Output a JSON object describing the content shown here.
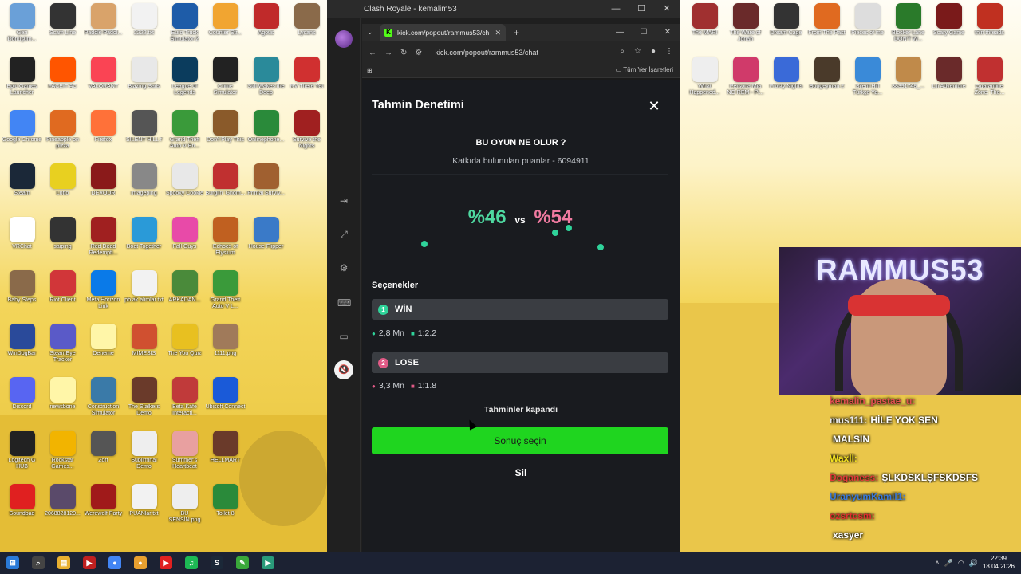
{
  "outer_window": {
    "title": "Clash Royale - kemalim53"
  },
  "browser": {
    "tab_title": "kick.com/popout/rammus53/ch",
    "url": "kick.com/popout/rammus53/chat",
    "bookmarks_all": "Tüm Yer İşaretleri"
  },
  "prediction": {
    "title": "Tahmin Denetimi",
    "question": "BU OYUN NE OLUR ?",
    "points_label": "Katkıda bulunulan puanlar - 6094911",
    "percent_a": "%46",
    "vs": "vs",
    "percent_b": "%54",
    "options_label": "Seçenekler",
    "options": [
      {
        "num": "1",
        "label": "WİN",
        "amount": "2,8 Mn",
        "ratio": "1:2.2",
        "color": "#2fd39a"
      },
      {
        "num": "2",
        "label": "LOSE",
        "amount": "3,3 Mn",
        "ratio": "1:1.8",
        "color": "#e05a86"
      }
    ],
    "closed_text": "Tahminler kapandı",
    "result_button": "Sonuç seçin",
    "delete_button": "Sil"
  },
  "chat_overlay": [
    {
      "user": "kemalin_pastae_u:",
      "text": ""
    },
    {
      "user": "mus111:",
      "text": "HİLE YOK SEN"
    },
    {
      "user": "",
      "text": "MALSIN"
    },
    {
      "user": "Waxll:",
      "text": ""
    },
    {
      "user": "Doganess:",
      "text": "ŞLKDSKLŞFSKDSFS"
    },
    {
      "user": "UranyumKamil1:",
      "text": ""
    },
    {
      "user": "ozsrtcsm:",
      "text": ""
    },
    {
      "user": "",
      "text": "xasyer"
    }
  ],
  "webcam": {
    "banner": "RAMMUS53"
  },
  "desktop_left_icons": [
    {
      "label": "Geri Dönüşüm...",
      "color": "#6aa0d8",
      "icon": "recycle-bin"
    },
    {
      "label": "Scam Line",
      "color": "#333",
      "icon": "app"
    },
    {
      "label": "Paddle Paddl...",
      "color": "#d9a36a",
      "icon": "app"
    },
    {
      "label": "2222.txt",
      "color": "#f2f2f2",
      "icon": "file"
    },
    {
      "label": "Euro Truck Simulator 2",
      "color": "#1e5ca8",
      "icon": "app"
    },
    {
      "label": "Counter Str...",
      "color": "#f1a531",
      "icon": "app"
    },
    {
      "label": "Agous",
      "color": "#c02a2a",
      "icon": "app"
    },
    {
      "label": "Lycans",
      "color": "#8a6a4a",
      "icon": "app"
    },
    {
      "label": "Epic Games Launcher",
      "color": "#222",
      "icon": "app"
    },
    {
      "label": "FACEIT AC",
      "color": "#ff5500",
      "icon": "app"
    },
    {
      "label": "VALORANT",
      "color": "#fa4454",
      "icon": "app"
    },
    {
      "label": "Blazing Sails",
      "color": "#e8e8e8",
      "icon": "app"
    },
    {
      "label": "League of Legends",
      "color": "#0b3c5d",
      "icon": "app"
    },
    {
      "label": "Crime Simulator",
      "color": "#222",
      "icon": "app"
    },
    {
      "label": "Still Wakes the Deep",
      "color": "#2a8a9a",
      "icon": "app"
    },
    {
      "label": "RV There Yet",
      "color": "#d03030",
      "icon": "app"
    },
    {
      "label": "Google Chrome",
      "color": "#4285f4",
      "icon": "app"
    },
    {
      "label": "Pineapple on pizza",
      "color": "#e06a20",
      "icon": "app"
    },
    {
      "label": "Firefox",
      "color": "#ff7139",
      "icon": "app"
    },
    {
      "label": "SILENT HILL f",
      "color": "#555",
      "icon": "app"
    },
    {
      "label": "Grand Theft Auto V En...",
      "color": "#3a9a3a",
      "icon": "app"
    },
    {
      "label": "Don't Play This",
      "color": "#8a5a2a",
      "icon": "app"
    },
    {
      "label": "Onlinephone...",
      "color": "#2a8a3a",
      "icon": "app"
    },
    {
      "label": "Survive the Nights",
      "color": "#a02020",
      "icon": "app"
    },
    {
      "label": "Steam",
      "color": "#1b2838",
      "icon": "app"
    },
    {
      "label": "Lotto",
      "color": "#e8d020",
      "icon": "app"
    },
    {
      "label": "DEVOUR",
      "color": "#8a1a1a",
      "icon": "app"
    },
    {
      "label": "imageping",
      "color": "#888",
      "icon": "file"
    },
    {
      "label": "Spooky Cookie",
      "color": "#e8e8e8",
      "icon": "file"
    },
    {
      "label": "Burglin' Gnom...",
      "color": "#c03030",
      "icon": "app"
    },
    {
      "label": "Primal Surviv...",
      "color": "#a06030",
      "icon": "app"
    },
    {
      "label": "",
      "color": "transparent",
      "icon": "blank"
    },
    {
      "label": "VRChat",
      "color": "#fff",
      "icon": "app"
    },
    {
      "label": "saiping",
      "color": "#333",
      "icon": "file"
    },
    {
      "label": "Red Dead Redempti...",
      "color": "#a02020",
      "icon": "app"
    },
    {
      "label": "Boat Together",
      "color": "#2a9ad8",
      "icon": "app"
    },
    {
      "label": "Fall Guys",
      "color": "#e84aa8",
      "icon": "app"
    },
    {
      "label": "Echoes of Elysium",
      "color": "#c06020",
      "icon": "app"
    },
    {
      "label": "House Flipper",
      "color": "#3a7ac8",
      "icon": "app"
    },
    {
      "label": "",
      "color": "transparent",
      "icon": "blank"
    },
    {
      "label": "Baby Steps",
      "color": "#8a6a4a",
      "icon": "app"
    },
    {
      "label": "Riot Client",
      "color": "#d13639",
      "icon": "app"
    },
    {
      "label": "Meta Horizon Link",
      "color": "#0a7ae8",
      "icon": "app"
    },
    {
      "label": "pb.ak alimlar.txt",
      "color": "#f2f2f2",
      "icon": "file"
    },
    {
      "label": "ARKADAN...",
      "color": "#4a8a3a",
      "icon": "app"
    },
    {
      "label": "Grand Theft Auto V L...",
      "color": "#3a9a3a",
      "icon": "app"
    },
    {
      "label": "",
      "color": "transparent",
      "icon": "blank"
    },
    {
      "label": "",
      "color": "transparent",
      "icon": "blank"
    },
    {
      "label": "WinDbgBar",
      "color": "#2a4a9a",
      "icon": "app"
    },
    {
      "label": "SteamEye Tracker",
      "color": "#5a5ac8",
      "icon": "app"
    },
    {
      "label": "Deneme",
      "color": "#fff6a8",
      "icon": "file"
    },
    {
      "label": "MIMESIS",
      "color": "#d05030",
      "icon": "app"
    },
    {
      "label": "The You Quiz",
      "color": "#e8c020",
      "icon": "app"
    },
    {
      "label": "1111.png",
      "color": "#a07a5a",
      "icon": "file"
    },
    {
      "label": "",
      "color": "transparent",
      "icon": "blank"
    },
    {
      "label": "",
      "color": "transparent",
      "icon": "blank"
    },
    {
      "label": "Discord",
      "color": "#5865f2",
      "icon": "app"
    },
    {
      "label": "newsbone",
      "color": "#fff6a8",
      "icon": "file"
    },
    {
      "label": "Construction Simulator",
      "color": "#3a7aa8",
      "icon": "app"
    },
    {
      "label": "The Stalkers Demo",
      "color": "#6a3a2a",
      "icon": "app"
    },
    {
      "label": "Beta Kafe Interacti...",
      "color": "#c03a3a",
      "icon": "app"
    },
    {
      "label": "Ubisoft Connect",
      "color": "#1a5ad8",
      "icon": "app"
    },
    {
      "label": "",
      "color": "transparent",
      "icon": "blank"
    },
    {
      "label": "",
      "color": "transparent",
      "icon": "blank"
    },
    {
      "label": "Logitech G HUB",
      "color": "#222",
      "icon": "app"
    },
    {
      "label": "Rockstar Games...",
      "color": "#f2b400",
      "icon": "app"
    },
    {
      "label": "Zort",
      "color": "#555",
      "icon": "app"
    },
    {
      "label": "Subliminal Demo",
      "color": "#eee",
      "icon": "app"
    },
    {
      "label": "Summer's Heartbeat",
      "color": "#e8a0a0",
      "icon": "app"
    },
    {
      "label": "HELLMART",
      "color": "#6a3a2a",
      "icon": "app"
    },
    {
      "label": "",
      "color": "transparent",
      "icon": "blank"
    },
    {
      "label": "",
      "color": "transparent",
      "icon": "blank"
    },
    {
      "label": "Soundpad",
      "color": "#e02020",
      "icon": "app"
    },
    {
      "label": "2068828120...",
      "color": "#5a4a6a",
      "icon": "file"
    },
    {
      "label": "Werewolf Party",
      "color": "#a01a1a",
      "icon": "app"
    },
    {
      "label": "PUANlar.txt",
      "color": "#f2f2f2",
      "icon": "file"
    },
    {
      "label": "BU SENSİN.png",
      "color": "#eee",
      "icon": "file"
    },
    {
      "label": "Toilet 8",
      "color": "#2a8a3a",
      "icon": "app"
    }
  ],
  "desktop_right_icons": [
    {
      "label": "The MARI",
      "color": "#a03030",
      "icon": "app"
    },
    {
      "label": "The Ware of Jonah",
      "color": "#6a2a2a",
      "icon": "app"
    },
    {
      "label": "Dream Cage",
      "color": "#333",
      "icon": "app"
    },
    {
      "label": "From The Past",
      "color": "#e06a20",
      "icon": "app"
    },
    {
      "label": "Pieces of me",
      "color": "#ddd",
      "icon": "app"
    },
    {
      "label": "Blocker Lane DON'T W...",
      "color": "#2a7a2a",
      "icon": "app"
    },
    {
      "label": "Scary Game",
      "color": "#7a1a1a",
      "icon": "app"
    },
    {
      "label": "thin threads",
      "color": "#c03020",
      "icon": "app"
    },
    {
      "label": "What Happened...",
      "color": "#eee",
      "icon": "app"
    },
    {
      "label": "Persona Mia NO REM - Pi...",
      "color": "#d03a6a",
      "icon": "app"
    },
    {
      "label": "Frosty Nights",
      "color": "#3a6ad8",
      "icon": "app"
    },
    {
      "label": "Boogeyman 2",
      "color": "#4a3a2a",
      "icon": "app"
    },
    {
      "label": "Silent Hill Türkçe Ya...",
      "color": "#3a8ad8",
      "icon": "app"
    },
    {
      "label": "38391748_...",
      "color": "#c08a4a",
      "icon": "file"
    },
    {
      "label": "Lili Adventure",
      "color": "#6a2a2a",
      "icon": "app"
    },
    {
      "label": "Quarantine Zone: The...",
      "color": "#c03030",
      "icon": "app"
    }
  ],
  "taskbar": {
    "items": [
      "start",
      "search",
      "explorer",
      "gaming",
      "chrome",
      "chrome-active",
      "youtube",
      "spotify",
      "steam",
      "notepad",
      "media"
    ],
    "time": "22:39",
    "date": "18.04.2026"
  }
}
